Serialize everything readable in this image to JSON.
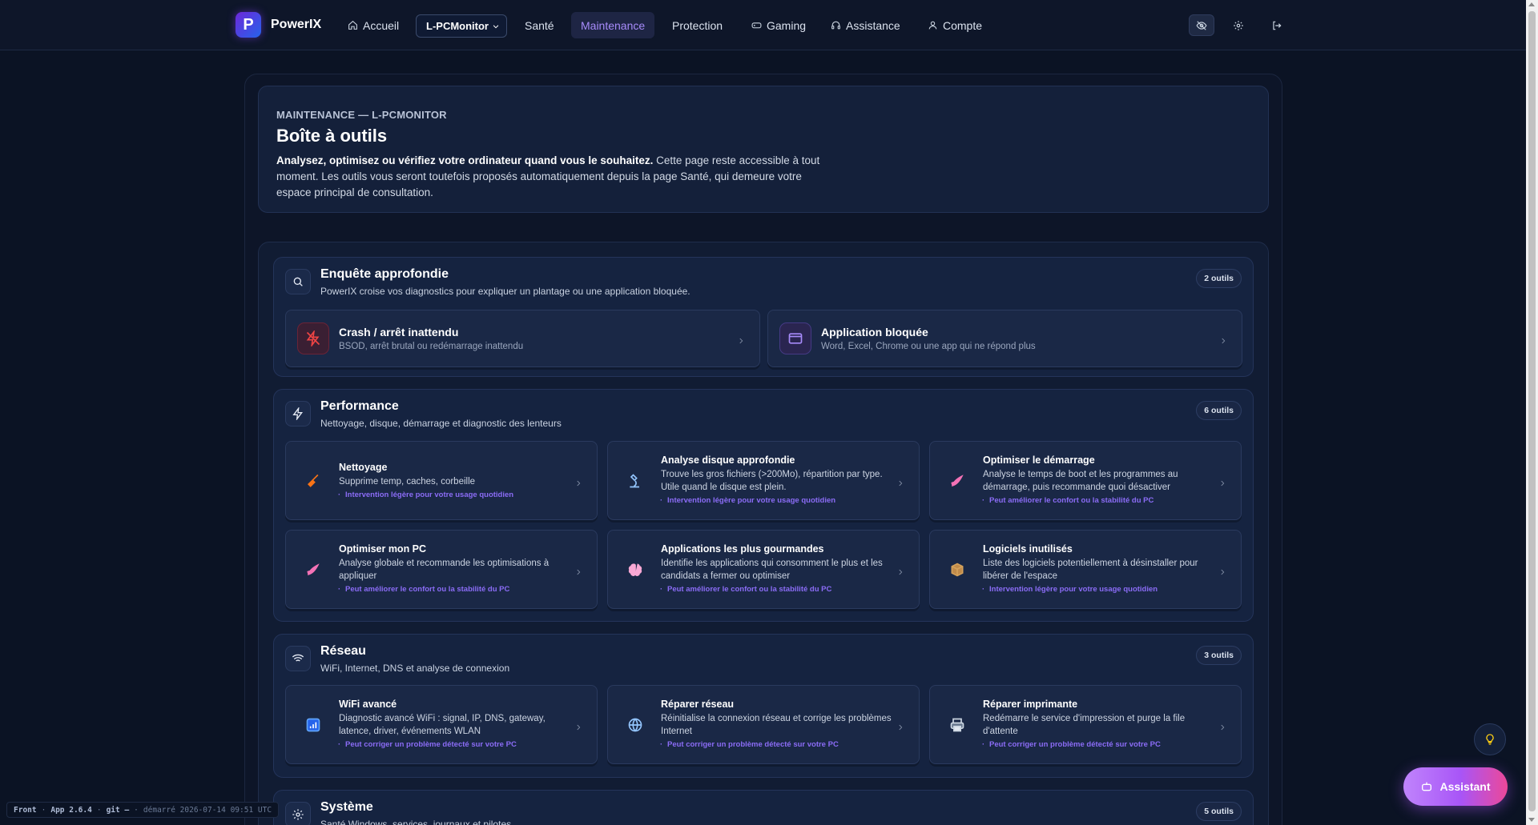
{
  "nav": {
    "brand": "PowerIX",
    "brand_letter": "P",
    "items": [
      {
        "label": "Accueil",
        "icon": "home-icon"
      },
      {
        "label": "Santé"
      },
      {
        "label": "Maintenance",
        "active": true
      },
      {
        "label": "Protection"
      },
      {
        "label": "Gaming",
        "icon": "gamepad-icon"
      },
      {
        "label": "Assistance",
        "icon": "headset-icon"
      },
      {
        "label": "Compte",
        "icon": "user-icon"
      }
    ],
    "pc_select": "L-PCMonitor",
    "right_icons": [
      "eye-off-icon",
      "gear-icon",
      "logout-icon"
    ]
  },
  "hero": {
    "eyebrow": "MAINTENANCE — L-PCMONITOR",
    "title": "Boîte à outils",
    "desc_bold": "Analysez, optimisez ou vérifiez votre ordinateur quand vous le souhaitez.",
    "desc_rest": " Cette page reste accessible à tout moment. Les outils vous seront toutefois proposés automatiquement depuis la page Santé, qui demeure votre espace principal de consultation."
  },
  "sections": {
    "enquete": {
      "title": "Enquête approfondie",
      "subtitle": "PowerIX croise vos diagnostics pour expliquer un plantage ou une application bloquée.",
      "badge": "2 outils",
      "cards": [
        {
          "title": "Crash / arrêt inattendu",
          "desc": "BSOD, arrêt brutal ou redémarrage inattendu",
          "icon": "crash-icon"
        },
        {
          "title": "Application bloquée",
          "desc": "Word, Excel, Chrome ou une app qui ne répond plus",
          "icon": "window-icon"
        }
      ]
    },
    "performance": {
      "title": "Performance",
      "subtitle": "Nettoyage, disque, démarrage et diagnostic des lenteurs",
      "badge": "6 outils",
      "cards": [
        {
          "title": "Nettoyage",
          "desc": "Supprime temp, caches, corbeille",
          "tag": "Intervention légère pour votre usage quotidien",
          "icon": "broom-icon"
        },
        {
          "title": "Analyse disque approfondie",
          "desc": "Trouve les gros fichiers (>200Mo), répartition par type. Utile quand le disque est plein.",
          "tag": "Intervention légère pour votre usage quotidien",
          "icon": "microscope-icon"
        },
        {
          "title": "Optimiser le démarrage",
          "desc": "Analyse le temps de boot et les programmes au démarrage, puis recommande quoi désactiver",
          "tag": "Peut améliorer le confort ou la stabilité du PC",
          "icon": "rocket-icon"
        },
        {
          "title": "Optimiser mon PC",
          "desc": "Analyse globale et recommande les optimisations à appliquer",
          "tag": "Peut améliorer le confort ou la stabilité du PC",
          "icon": "rocket-icon"
        },
        {
          "title": "Applications les plus gourmandes",
          "desc": "Identifie les applications qui consomment le plus et les candidats a fermer ou optimiser",
          "tag": "Peut améliorer le confort ou la stabilité du PC",
          "icon": "brain-icon"
        },
        {
          "title": "Logiciels inutilisés",
          "desc": "Liste des logiciels potentiellement à désinstaller pour libérer de l'espace",
          "tag": "Intervention légère pour votre usage quotidien",
          "icon": "package-icon"
        }
      ]
    },
    "reseau": {
      "title": "Réseau",
      "subtitle": "WiFi, Internet, DNS et analyse de connexion",
      "badge": "3 outils",
      "cards": [
        {
          "title": "WiFi avancé",
          "desc": "Diagnostic avancé WiFi : signal, IP, DNS, gateway, latence, driver, événements WLAN",
          "tag": "Peut corriger un problème détecté sur votre PC",
          "icon": "signal-bars-icon"
        },
        {
          "title": "Réparer réseau",
          "desc": "Réinitialise la connexion réseau et corrige les problèmes Internet",
          "tag": "Peut corriger un problème détecté sur votre PC",
          "icon": "globe-icon"
        },
        {
          "title": "Réparer imprimante",
          "desc": "Redémarre le service d'impression et purge la file d'attente",
          "tag": "Peut corriger un problème détecté sur votre PC",
          "icon": "printer-icon"
        }
      ]
    },
    "systeme": {
      "title": "Système",
      "subtitle": "Santé Windows, services, journaux et pilotes",
      "badge": "5 outils"
    }
  },
  "build": {
    "front": "Front",
    "app": "App 2.6.4",
    "git": "git —",
    "started": "démarré 2026-07-14 09:51 UTC"
  },
  "assistant": {
    "label": "Assistant"
  },
  "colors": {
    "accent": "#a78bfa",
    "tag": "#8b6cf6",
    "bg": "#0b1324"
  }
}
